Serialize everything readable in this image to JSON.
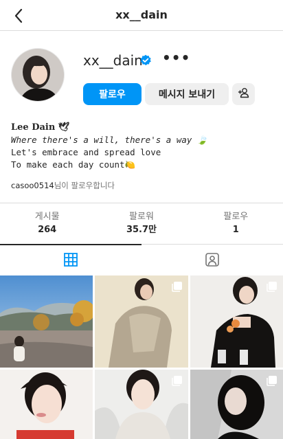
{
  "header": {
    "title": "xx__dain",
    "back_icon": "chevron-left-icon"
  },
  "profile": {
    "username": "xx__dain",
    "verified_icon": "verified-badge-icon",
    "more_icon": "more-horizontal-icon",
    "more_text": "•••",
    "follow_label": "팔로우",
    "message_label": "메시지 보내기",
    "add_user_icon": "add-user-icon"
  },
  "bio": {
    "name": "Lee Dain 🕊",
    "lines": [
      "Where there's a will, there's a way 🍃",
      "Let's embrace and spread love",
      "To make each day count🍋"
    ],
    "followed_by_user": "casoo0514",
    "followed_by_suffix": "님이 팔로우합니다"
  },
  "stats": [
    {
      "label": "게시물",
      "value": "264"
    },
    {
      "label": "팔로워",
      "value": "35.7만"
    },
    {
      "label": "팔로우",
      "value": "1"
    }
  ],
  "tabs": [
    {
      "name": "posts-grid",
      "icon": "grid-icon",
      "active": true
    },
    {
      "name": "tagged",
      "icon": "tagged-user-icon",
      "active": false
    }
  ],
  "colors": {
    "accent": "#0095f6",
    "verified": "#0095f6",
    "tab_active": "#0095f6"
  },
  "posts": [
    {
      "icon": null
    },
    {
      "icon": "multi-photo-icon"
    },
    {
      "icon": "multi-photo-icon"
    },
    {
      "icon": null
    },
    {
      "icon": "multi-photo-icon"
    },
    {
      "icon": "reel-icon"
    }
  ]
}
